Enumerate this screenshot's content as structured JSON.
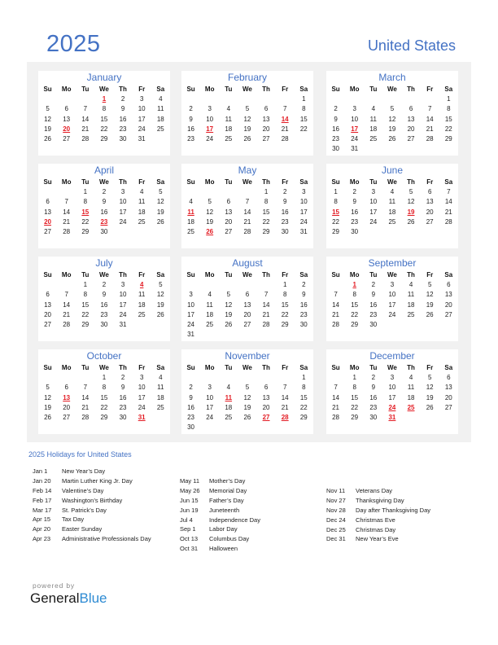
{
  "header": {
    "year": "2025",
    "country": "United States"
  },
  "weekdays": [
    "Su",
    "Mo",
    "Tu",
    "We",
    "Th",
    "Fr",
    "Sa"
  ],
  "months": [
    {
      "name": "January",
      "start": 3,
      "days": 31,
      "holidays": [
        1,
        20
      ]
    },
    {
      "name": "February",
      "start": 6,
      "days": 28,
      "holidays": [
        14,
        17
      ]
    },
    {
      "name": "March",
      "start": 6,
      "days": 31,
      "holidays": [
        17
      ]
    },
    {
      "name": "April",
      "start": 2,
      "days": 30,
      "holidays": [
        15,
        20,
        23
      ]
    },
    {
      "name": "May",
      "start": 4,
      "days": 31,
      "holidays": [
        11,
        26
      ]
    },
    {
      "name": "June",
      "start": 0,
      "days": 30,
      "holidays": [
        15,
        19
      ]
    },
    {
      "name": "July",
      "start": 2,
      "days": 31,
      "holidays": [
        4
      ]
    },
    {
      "name": "August",
      "start": 5,
      "days": 31,
      "holidays": []
    },
    {
      "name": "September",
      "start": 1,
      "days": 30,
      "holidays": [
        1
      ]
    },
    {
      "name": "October",
      "start": 3,
      "days": 31,
      "holidays": [
        13,
        31
      ]
    },
    {
      "name": "November",
      "start": 6,
      "days": 30,
      "holidays": [
        11,
        27,
        28
      ]
    },
    {
      "name": "December",
      "start": 1,
      "days": 31,
      "holidays": [
        24,
        25,
        31
      ]
    }
  ],
  "holidays_section": {
    "title": "2025 Holidays for United States",
    "columns": [
      [
        {
          "date": "Jan 1",
          "name": "New Year’s Day"
        },
        {
          "date": "Jan 20",
          "name": "Martin Luther King Jr. Day"
        },
        {
          "date": "Feb 14",
          "name": "Valentine’s Day"
        },
        {
          "date": "Feb 17",
          "name": "Washington’s Birthday"
        },
        {
          "date": "Mar 17",
          "name": "St. Patrick’s Day"
        },
        {
          "date": "Apr 15",
          "name": "Tax Day"
        },
        {
          "date": "Apr 20",
          "name": "Easter Sunday"
        },
        {
          "date": "Apr 23",
          "name": "Administrative Professionals Day"
        }
      ],
      [
        {
          "date": "May 11",
          "name": "Mother’s Day"
        },
        {
          "date": "May 26",
          "name": "Memorial Day"
        },
        {
          "date": "Jun 15",
          "name": "Father’s Day"
        },
        {
          "date": "Jun 19",
          "name": "Juneteenth"
        },
        {
          "date": "Jul 4",
          "name": "Independence Day"
        },
        {
          "date": "Sep 1",
          "name": "Labor Day"
        },
        {
          "date": "Oct 13",
          "name": "Columbus Day"
        },
        {
          "date": "Oct 31",
          "name": "Halloween"
        }
      ],
      [
        {
          "date": "Nov 11",
          "name": "Veterans Day"
        },
        {
          "date": "Nov 27",
          "name": "Thanksgiving Day"
        },
        {
          "date": "Nov 28",
          "name": "Day after Thanksgiving Day"
        },
        {
          "date": "Dec 24",
          "name": "Christmas Eve"
        },
        {
          "date": "Dec 25",
          "name": "Christmas Day"
        },
        {
          "date": "Dec 31",
          "name": "New Year’s Eve"
        }
      ]
    ]
  },
  "footer": {
    "powered_by": "powered by",
    "brand_general": "General",
    "brand_blue": "Blue"
  },
  "colors": {
    "accent": "#4472c4",
    "holiday": "#e31b23",
    "panel": "#f1f1f1",
    "brand_blue": "#2e8bd3"
  }
}
